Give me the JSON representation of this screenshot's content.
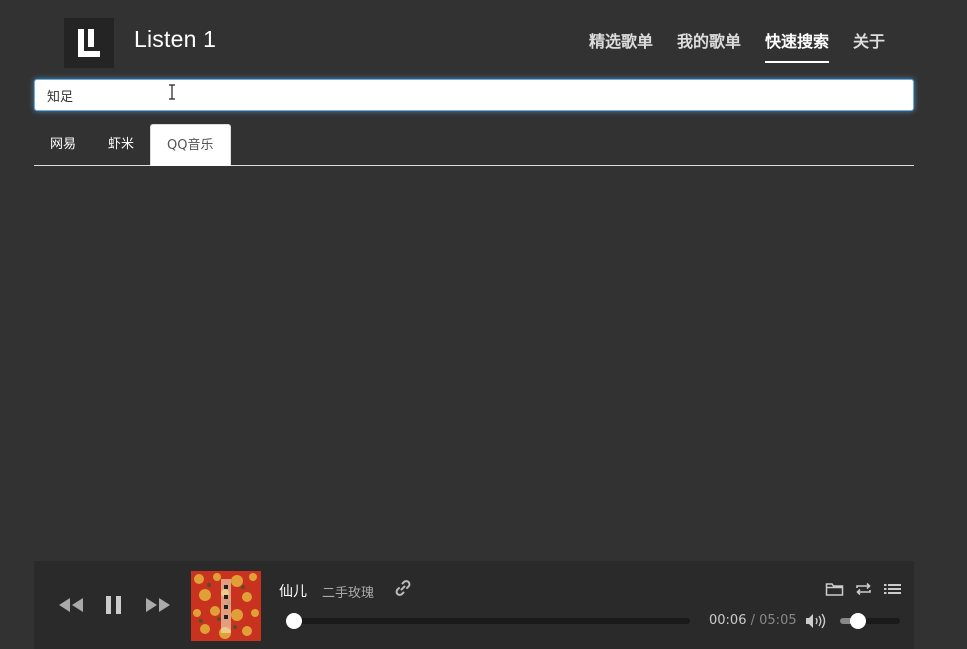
{
  "app": {
    "logo_icon": "listen1-logo-icon",
    "title": "Listen 1"
  },
  "nav": {
    "items": [
      {
        "label": "精选歌单",
        "active": false
      },
      {
        "label": "我的歌单",
        "active": false
      },
      {
        "label": "快速搜索",
        "active": true
      },
      {
        "label": "关于",
        "active": false
      }
    ]
  },
  "search": {
    "value": "知足",
    "placeholder": ""
  },
  "tabs": {
    "items": [
      {
        "label": "网易",
        "active": false
      },
      {
        "label": "虾米",
        "active": false
      },
      {
        "label": "QQ音乐",
        "active": true
      }
    ]
  },
  "player": {
    "song_title": "仙儿",
    "artist": "二手玫瑰",
    "current_time": "00:06",
    "separator": "/",
    "total_time": "05:05",
    "progress_fraction": 0.02,
    "volume_fraction": 0.3,
    "icons": {
      "prev": "rewind-icon",
      "pause": "pause-icon",
      "next": "fast-forward-icon",
      "link": "link-icon",
      "volume": "volume-icon",
      "folder": "folder-icon",
      "repeat": "repeat-icon",
      "playlist": "playlist-icon"
    },
    "colors": {
      "cover_red": "#c8321e",
      "cover_gold": "#e6b43c"
    }
  }
}
